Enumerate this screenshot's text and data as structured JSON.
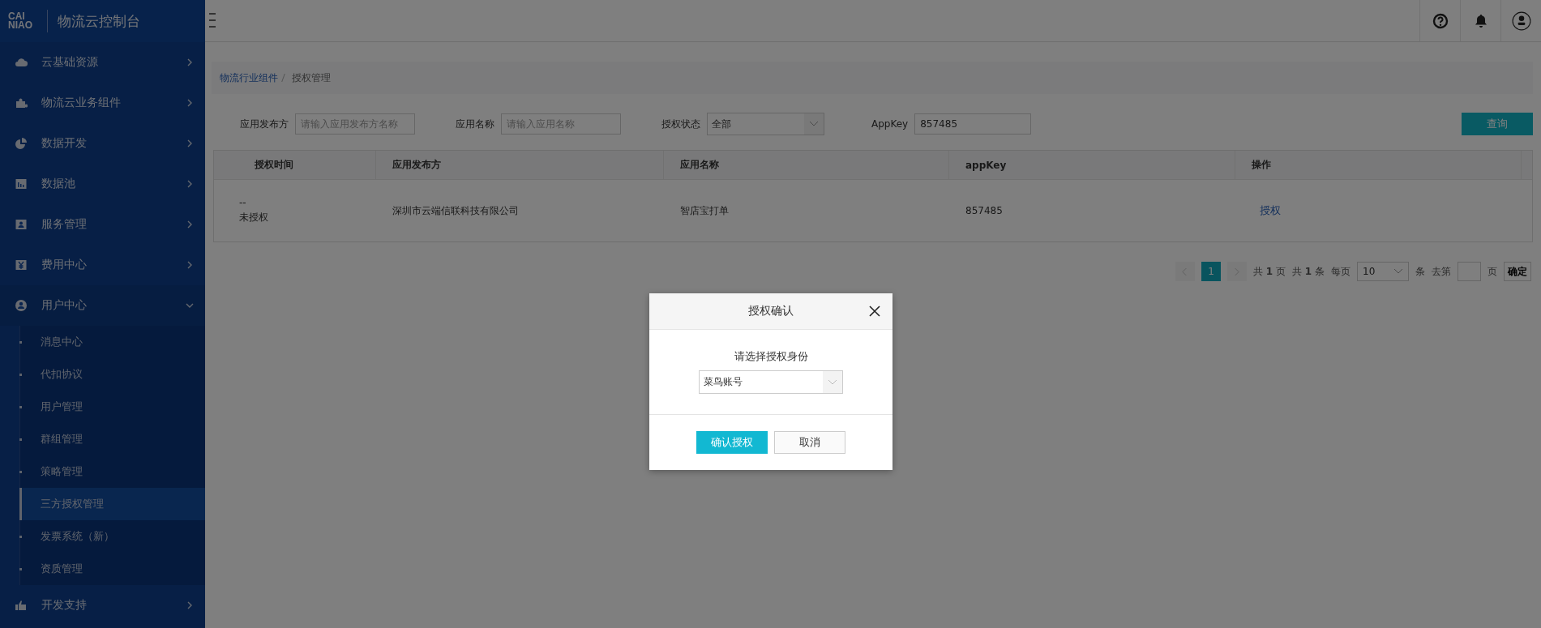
{
  "brand": {
    "logo_line1": "CAI",
    "logo_line2": "NIAO",
    "title": "物流云控制台"
  },
  "sidebar": {
    "items": [
      {
        "label": "云基础资源",
        "expanded": false
      },
      {
        "label": "物流云业务组件",
        "expanded": false
      },
      {
        "label": "数据开发",
        "expanded": false
      },
      {
        "label": "数据池",
        "expanded": false
      },
      {
        "label": "服务管理",
        "expanded": false
      },
      {
        "label": "费用中心",
        "expanded": false
      },
      {
        "label": "用户中心",
        "expanded": true,
        "children": [
          {
            "label": "消息中心",
            "selected": false
          },
          {
            "label": "代扣协议",
            "selected": false
          },
          {
            "label": "用户管理",
            "selected": false
          },
          {
            "label": "群组管理",
            "selected": false
          },
          {
            "label": "策略管理",
            "selected": false
          },
          {
            "label": "三方授权管理",
            "selected": true
          },
          {
            "label": "发票系统（新）",
            "selected": false
          },
          {
            "label": "资质管理",
            "selected": false
          }
        ]
      },
      {
        "label": "开发支持",
        "expanded": false
      }
    ]
  },
  "breadcrumb": [
    "物流行业组件",
    "授权管理"
  ],
  "filters": [
    {
      "kind": "input",
      "label": "应用发布方",
      "placeholder": "请输入应用发布方名称"
    },
    {
      "kind": "input",
      "label": "应用名称",
      "placeholder": "请输入应用名称"
    },
    {
      "kind": "select",
      "label": "授权状态",
      "value": "全部"
    },
    {
      "kind": "input",
      "label": "AppKey",
      "value": "857485"
    }
  ],
  "query_button": "查询",
  "table": {
    "columns": [
      "授权时间",
      "应用发布方",
      "应用名称",
      "appKey",
      "操作"
    ],
    "rows": [
      {
        "time": "--",
        "status": "未授权",
        "publisher": "深圳市云端信联科技有限公司",
        "app": "智店宝打单",
        "app_key": "857485",
        "action": "授权"
      }
    ]
  },
  "pagination": {
    "pages": [
      {
        "label": "1",
        "selected": true
      }
    ],
    "total_pages": "共 **1** 页",
    "total_items": "共 **1** 条",
    "per_page_label": "每页",
    "per_page": "10",
    "per_page_unit": "条",
    "goto_label": "去第",
    "goto_unit": "页",
    "goto_button": "确定"
  },
  "dialog": {
    "title": "授权确认",
    "prompt": "请选择授权身份",
    "identity": "菜鸟账号",
    "confirm": "确认授权",
    "cancel": "取消"
  }
}
